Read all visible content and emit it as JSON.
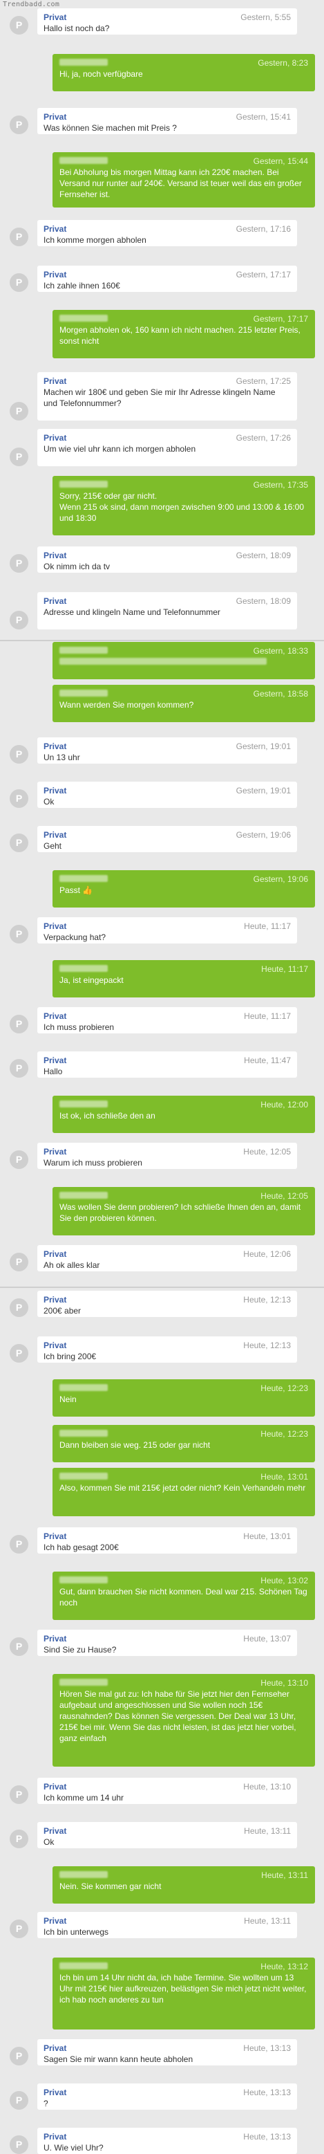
{
  "watermark": "Trendbadd.com",
  "avatar_letter": "P",
  "messages": [
    {
      "dir": "in",
      "sender": "Privat",
      "time": "Gestern, 5:55",
      "text": "Hallo ist noch da?"
    },
    {
      "dir": "out",
      "sender": "",
      "time": "Gestern, 8:23",
      "text": "Hi, ja, noch verfügbare"
    },
    {
      "dir": "in",
      "sender": "Privat",
      "time": "Gestern, 15:41",
      "text": "Was können Sie machen mit Preis ?"
    },
    {
      "dir": "out",
      "sender": "",
      "time": "Gestern, 15:44",
      "text": "Bei Abholung bis morgen Mittag kann ich 220€ machen. Bei Versand nur runter auf 240€. Versand ist teuer weil das ein großer Fernseher ist."
    },
    {
      "dir": "in",
      "sender": "Privat",
      "time": "Gestern, 17:16",
      "text": "Ich komme morgen abholen"
    },
    {
      "dir": "in",
      "sender": "Privat",
      "time": "Gestern, 17:17",
      "text": "Ich zahle ihnen 160€"
    },
    {
      "dir": "out",
      "sender": "",
      "time": "Gestern, 17:17",
      "text": "Morgen abholen ok, 160 kann ich nicht machen. 215 letzter Preis, sonst nicht"
    },
    {
      "dir": "in",
      "sender": "Privat",
      "time": "Gestern, 17:25",
      "text": "Machen wir 180€ und geben Sie mir Ihr Adresse klingeln Name und Telefonnummer?"
    },
    {
      "dir": "in",
      "sender": "Privat",
      "time": "Gestern, 17:26",
      "text": "Um wie viel uhr kann ich morgen abholen"
    },
    {
      "dir": "out",
      "sender": "",
      "time": "Gestern, 17:35",
      "text": "Sorry, 215€ oder gar nicht.\nWenn 215 ok sind, dann morgen zwischen 9:00 und 13:00 & 16:00 und 18:30"
    },
    {
      "dir": "in",
      "sender": "Privat",
      "time": "Gestern, 18:09",
      "text": "Ok nimm ich da tv"
    },
    {
      "dir": "in",
      "sender": "Privat",
      "time": "Gestern, 18:09",
      "text": "Adresse und klingeln Name und Telefonnummer"
    },
    {
      "dir": "out",
      "sender": "",
      "time": "Gestern, 18:33",
      "text": ""
    },
    {
      "dir": "out",
      "sender": "",
      "time": "Gestern, 18:58",
      "text": "Wann werden Sie morgen kommen?"
    },
    {
      "dir": "in",
      "sender": "Privat",
      "time": "Gestern, 19:01",
      "text": "Un 13 uhr"
    },
    {
      "dir": "in",
      "sender": "Privat",
      "time": "Gestern, 19:01",
      "text": "Ok"
    },
    {
      "dir": "in",
      "sender": "Privat",
      "time": "Gestern, 19:06",
      "text": "Geht"
    },
    {
      "dir": "out",
      "sender": "",
      "time": "Gestern, 19:06",
      "text": "Passt 👍"
    },
    {
      "dir": "in",
      "sender": "Privat",
      "time": "Heute, 11:17",
      "text": "Verpackung hat?"
    },
    {
      "dir": "out",
      "sender": "",
      "time": "Heute, 11:17",
      "text": "Ja, ist eingepackt"
    },
    {
      "dir": "in",
      "sender": "Privat",
      "time": "Heute, 11:17",
      "text": "Ich muss probieren"
    },
    {
      "dir": "in",
      "sender": "Privat",
      "time": "Heute, 11:47",
      "text": "Hallo"
    },
    {
      "dir": "out",
      "sender": "",
      "time": "Heute, 12:00",
      "text": "Ist ok, ich schließe den an"
    },
    {
      "dir": "in",
      "sender": "Privat",
      "time": "Heute, 12:05",
      "text": "Warum ich muss probieren"
    },
    {
      "dir": "out",
      "sender": "",
      "time": "Heute, 12:05",
      "text": "Was wollen Sie denn probieren? Ich schließe Ihnen den an, damit Sie den probieren können."
    },
    {
      "dir": "in",
      "sender": "Privat",
      "time": "Heute, 12:06",
      "text": "Ah ok alles klar"
    },
    {
      "dir": "in",
      "sender": "Privat",
      "time": "Heute, 12:13",
      "text": "200€ aber"
    },
    {
      "dir": "in",
      "sender": "Privat",
      "time": "Heute, 12:13",
      "text": "Ich bring 200€"
    },
    {
      "dir": "out",
      "sender": "",
      "time": "Heute, 12:23",
      "text": "Nein"
    },
    {
      "dir": "out",
      "sender": "",
      "time": "Heute, 12:23",
      "text": "Dann bleiben sie weg. 215 oder gar nicht"
    },
    {
      "dir": "out",
      "sender": "",
      "time": "Heute, 13:01",
      "text": "Also, kommen Sie mit 215€ jetzt oder nicht? Kein Verhandeln mehr"
    },
    {
      "dir": "in",
      "sender": "Privat",
      "time": "Heute, 13:01",
      "text": "Ich hab gesagt 200€"
    },
    {
      "dir": "out",
      "sender": "",
      "time": "Heute, 13:02",
      "text": "Gut, dann brauchen Sie nicht kommen. Deal war 215. Schönen Tag noch"
    },
    {
      "dir": "in",
      "sender": "Privat",
      "time": "Heute, 13:07",
      "text": "Sind Sie zu Hause?"
    },
    {
      "dir": "out",
      "sender": "",
      "time": "Heute, 13:10",
      "text": "Hören Sie mal gut zu: Ich habe für Sie jetzt hier den Fernseher aufgebaut und angeschlossen und Sie wollen noch 15€ rausnahnden? Das können Sie vergessen. Der Deal war 13 Uhr, 215€ bei mir. Wenn Sie das nicht leisten, ist das jetzt hier vorbei, ganz einfach"
    },
    {
      "dir": "in",
      "sender": "Privat",
      "time": "Heute, 13:10",
      "text": "Ich komme um 14 uhr"
    },
    {
      "dir": "in",
      "sender": "Privat",
      "time": "Heute, 13:11",
      "text": "Ok"
    },
    {
      "dir": "out",
      "sender": "",
      "time": "Heute, 13:11",
      "text": "Nein. Sie kommen gar nicht"
    },
    {
      "dir": "in",
      "sender": "Privat",
      "time": "Heute, 13:11",
      "text": "Ich bin unterwegs"
    },
    {
      "dir": "out",
      "sender": "",
      "time": "Heute, 13:12",
      "text": "Ich bin um 14 Uhr nicht da, ich habe Termine. Sie wollten um 13 Uhr mit 215€ hier aufkreuzen, belästigen Sie mich jetzt nicht weiter, ich hab noch anderes zu tun"
    },
    {
      "dir": "in",
      "sender": "Privat",
      "time": "Heute, 13:13",
      "text": "Sagen Sie mir wann kann heute abholen"
    },
    {
      "dir": "in",
      "sender": "Privat",
      "time": "Heute, 13:13",
      "text": "?"
    },
    {
      "dir": "in",
      "sender": "Privat",
      "time": "Heute, 13:13",
      "text": "U. Wie viel Uhr?"
    }
  ]
}
